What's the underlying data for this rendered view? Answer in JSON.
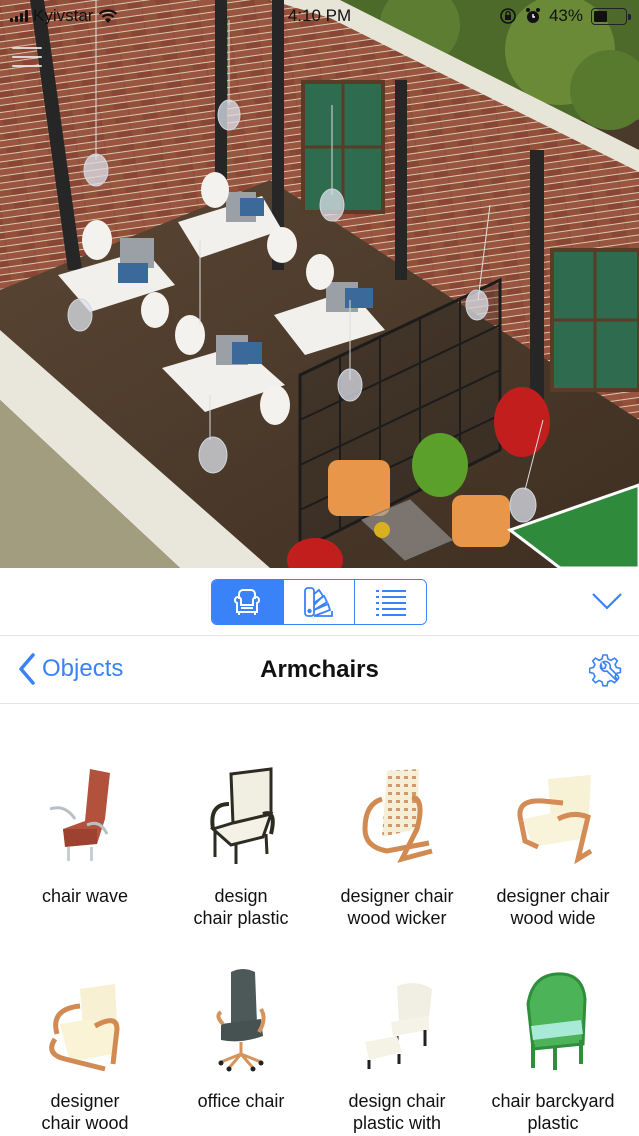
{
  "status_bar": {
    "carrier": "Kyivstar",
    "time": "4:10 PM",
    "battery_percent_label": "43%",
    "battery_level": 0.43,
    "icons": [
      "signal-icon",
      "wifi-icon",
      "orientation-lock-icon",
      "alarm-icon",
      "battery-icon"
    ]
  },
  "scene": {
    "description": "3D isometric view of office interior with brick walls, desks, monitors, chairs, pendant lamps, bean bags, room divider and ping-pong table",
    "menu_icon": "hamburger-menu-icon"
  },
  "toolbar": {
    "segments": [
      {
        "id": "furniture",
        "icon": "armchair-icon",
        "active": true
      },
      {
        "id": "materials",
        "icon": "color-swatch-icon",
        "active": false
      },
      {
        "id": "list",
        "icon": "list-icon",
        "active": false
      }
    ],
    "collapse_icon": "chevron-down-icon"
  },
  "navbar": {
    "back_label": "Objects",
    "title": "Armchairs",
    "settings_icon": "gear-wrench-icon"
  },
  "items": [
    {
      "label_line1": "chair wave",
      "label_line2": ""
    },
    {
      "label_line1": "design",
      "label_line2": "chair plastic"
    },
    {
      "label_line1": "designer chair",
      "label_line2": "wood wicker"
    },
    {
      "label_line1": "designer chair",
      "label_line2": "wood wide"
    },
    {
      "label_line1": "designer",
      "label_line2": "chair wood"
    },
    {
      "label_line1": "office chair",
      "label_line2": ""
    },
    {
      "label_line1": "design chair",
      "label_line2": "plastic with"
    },
    {
      "label_line1": "chair barckyard",
      "label_line2": "plastic"
    }
  ],
  "colors": {
    "accent": "#3a82f7",
    "brick": "#8a4a36",
    "floor": "#4a3a2c",
    "beam": "#262626"
  }
}
